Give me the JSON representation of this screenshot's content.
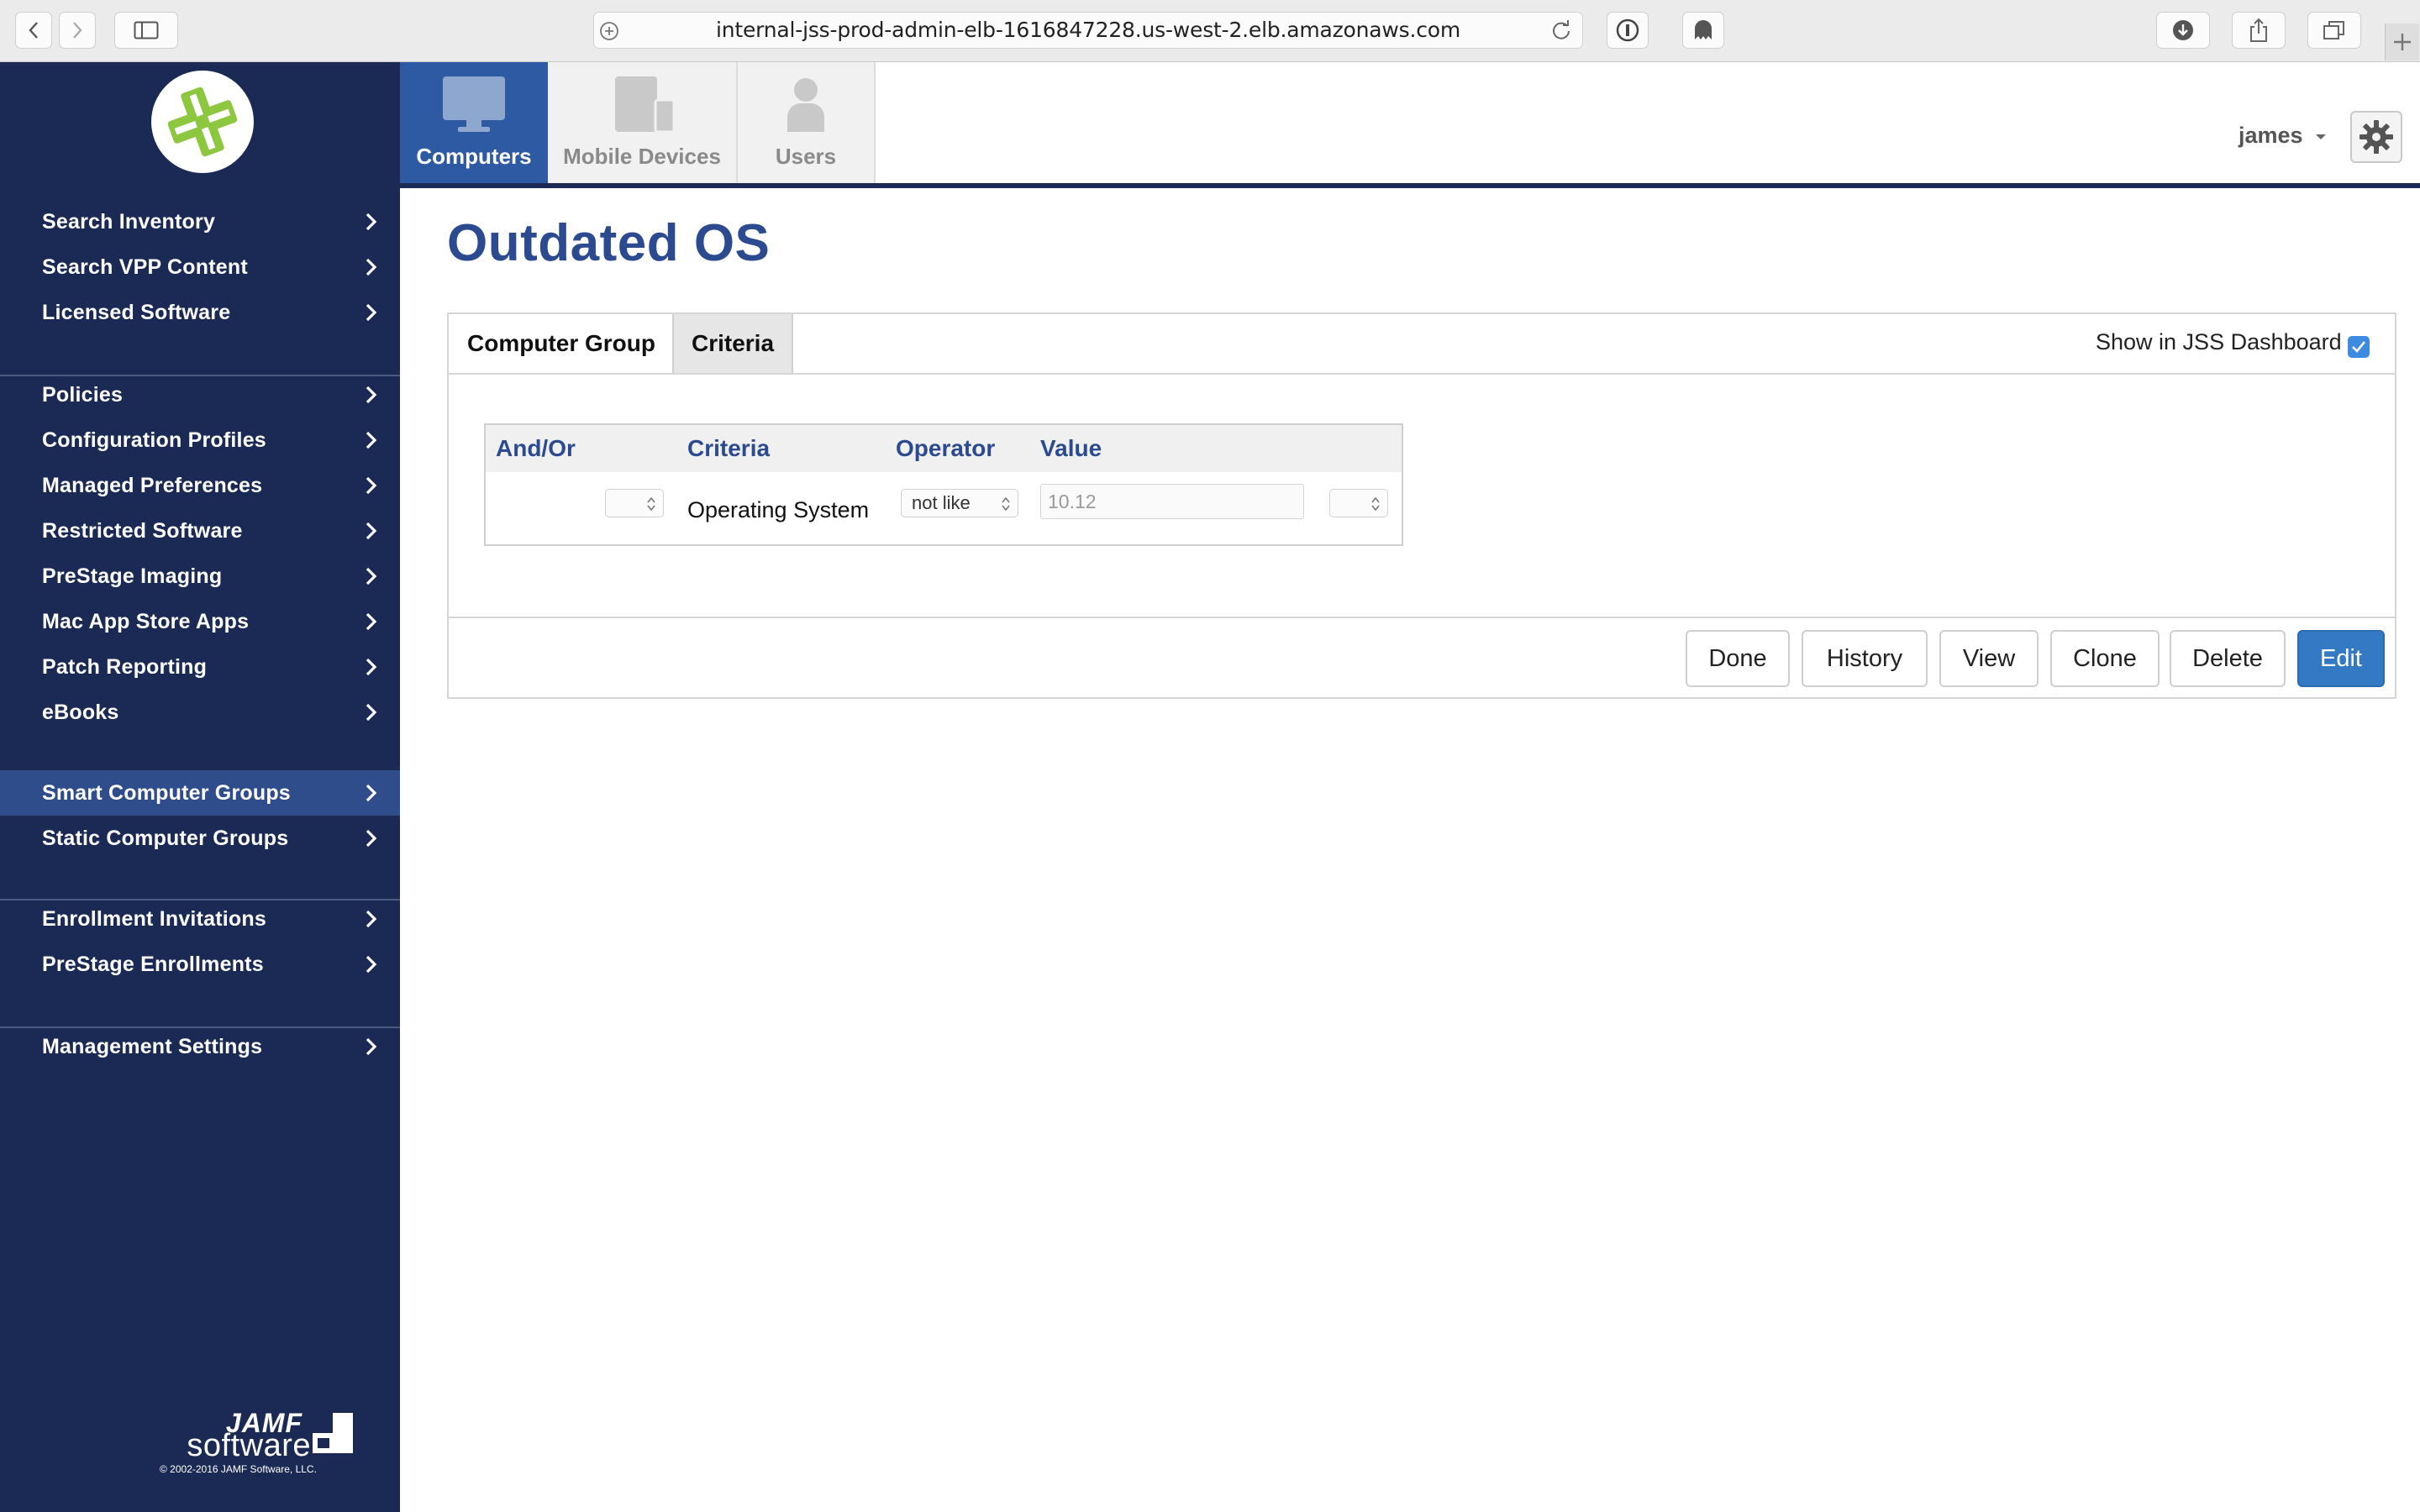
{
  "browser": {
    "url": "internal-jss-prod-admin-elb-1616847228.us-west-2.elb.amazonaws.com"
  },
  "sidebar": {
    "groups": [
      [
        {
          "label": "Search Inventory"
        },
        {
          "label": "Search VPP Content"
        },
        {
          "label": "Licensed Software"
        }
      ],
      [
        {
          "label": "Policies"
        },
        {
          "label": "Configuration Profiles"
        },
        {
          "label": "Managed Preferences"
        },
        {
          "label": "Restricted Software"
        },
        {
          "label": "PreStage Imaging"
        },
        {
          "label": "Mac App Store Apps"
        },
        {
          "label": "Patch Reporting"
        },
        {
          "label": "eBooks"
        }
      ],
      [
        {
          "label": "Smart Computer Groups",
          "active": true
        },
        {
          "label": "Static Computer Groups"
        }
      ],
      [
        {
          "label": "Enrollment Invitations"
        },
        {
          "label": "PreStage Enrollments"
        }
      ],
      [
        {
          "label": "Management Settings"
        }
      ]
    ],
    "brand": {
      "jamf": "JAMF",
      "software": "software",
      "copyright": "© 2002-2016 JAMF Software, LLC."
    },
    "bg_color": "#1b2a55",
    "active_color": "#2e4d8a"
  },
  "topnav": {
    "tabs": [
      {
        "label": "Computers",
        "icon": "monitor-icon",
        "active": true
      },
      {
        "label": "Mobile Devices",
        "icon": "mobile-devices-icon"
      },
      {
        "label": "Users",
        "icon": "user-icon"
      }
    ],
    "user": "james",
    "accent": "#2d5aa3"
  },
  "page": {
    "title": "Outdated OS"
  },
  "panel": {
    "tabs": [
      "Computer Group",
      "Criteria"
    ],
    "active_tab": "Criteria",
    "dashboard_label": "Show in JSS Dashboard",
    "dashboard_checked": true,
    "criteria_headers": [
      "And/Or",
      "Criteria",
      "Operator",
      "Value"
    ],
    "criteria_rows": [
      {
        "andor": "",
        "criteria": "Operating System",
        "operator": "not like",
        "value": "10.12",
        "paren": ""
      }
    ],
    "buttons": [
      "Done",
      "History",
      "View",
      "Clone",
      "Delete",
      "Edit"
    ],
    "primary_button": "Edit"
  }
}
